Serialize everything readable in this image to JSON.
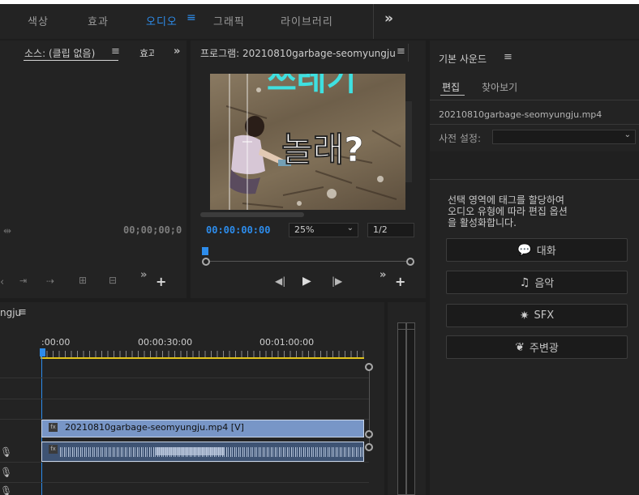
{
  "workspaces": {
    "items": [
      {
        "label": "색상",
        "active": false
      },
      {
        "label": "효과",
        "active": false
      },
      {
        "label": "오디오",
        "active": true
      },
      {
        "label": "그래픽",
        "active": false
      },
      {
        "label": "라이브러리",
        "active": false
      }
    ],
    "menu_icon": "hamburger-icon",
    "more_icon": "double-chevron-right-icon",
    "accent": "#2d8ceb"
  },
  "source": {
    "tab_label": "소스: (클립 없음)",
    "next_tab_label": "효과",
    "timecode": "00;00;00;0",
    "menu_glyph": "≡",
    "more_glyph": "»",
    "add_glyph": "+"
  },
  "program": {
    "title": "프로그램: 20210810garbage-seomyungju",
    "timecode": "00:00:00:00",
    "zoom": "25%",
    "resolution": "1/2",
    "overlay_top": "쓰레기",
    "overlay_main": "놀래?",
    "menu_glyph": "≡",
    "more_glyph": "»",
    "add_glyph": "+"
  },
  "essential_sound": {
    "title": "기본 사운드",
    "tabs": [
      {
        "label": "편집",
        "active": true
      },
      {
        "label": "찾아보기",
        "active": false
      }
    ],
    "file_name": "20210810garbage-seomyungju.mp4",
    "preset_label": "사전 설정:",
    "preset_value": "",
    "instructions": "선택 영역에 태그를 할당하여\n오디오 유형에 따라 편집 옵션\n을 활성화합니다.",
    "buttons": [
      {
        "label": "대화",
        "icon": "speech-bubble-icon",
        "glyph": "💬"
      },
      {
        "label": "음악",
        "icon": "music-note-icon",
        "glyph": "♫"
      },
      {
        "label": "SFX",
        "icon": "burst-icon",
        "glyph": "✷"
      },
      {
        "label": "주변광",
        "icon": "leaf-icon",
        "glyph": "❦"
      }
    ],
    "menu_glyph": "≡"
  },
  "timeline": {
    "sequence_name": "ngju",
    "menu_glyph": "≡",
    "ruler": [
      ":00:00",
      "00:00:30:00",
      "00:01:00:00"
    ],
    "video_clip_label": "20210810garbage-seomyungju.mp4 [V]",
    "fx_badge": "fx"
  }
}
